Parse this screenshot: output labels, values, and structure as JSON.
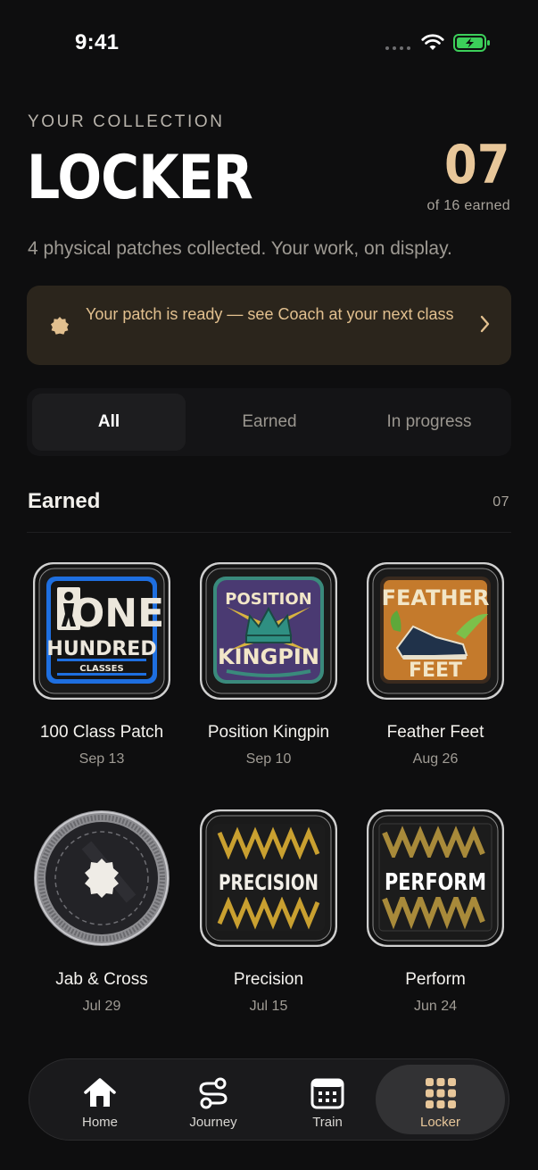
{
  "status_bar": {
    "time": "9:41"
  },
  "header": {
    "eyebrow": "YOUR COLLECTION",
    "title": "LOCKER",
    "count": "07",
    "count_sub": "of 16 earned",
    "subtitle": "4 physical patches collected. Your work, on display."
  },
  "banner": {
    "text": "Your patch is ready — see Coach at your next class",
    "accent": "#e2c08f"
  },
  "segments": [
    {
      "label": "All",
      "active": true
    },
    {
      "label": "Earned",
      "active": false
    },
    {
      "label": "In progress",
      "active": false
    }
  ],
  "section": {
    "title": "Earned",
    "count": "07"
  },
  "patches": [
    {
      "name": "100 Class Patch",
      "date": "Sep 13",
      "art": [
        "ONE",
        "HUNDRED",
        "CLASSES"
      ]
    },
    {
      "name": "Position Kingpin",
      "date": "Sep 10",
      "art": [
        "POSITION",
        "KINGPIN"
      ]
    },
    {
      "name": "Feather Feet",
      "date": "Aug 26",
      "art": [
        "FEATHER",
        "FEET"
      ]
    },
    {
      "name": "Jab & Cross",
      "date": "Jul 29"
    },
    {
      "name": "Precision",
      "date": "Jul 15",
      "art": [
        "PRECISION"
      ]
    },
    {
      "name": "Perform",
      "date": "Jun 24",
      "art": [
        "PERFORM"
      ]
    }
  ],
  "tabs": [
    {
      "label": "Home",
      "icon": "home-icon"
    },
    {
      "label": "Journey",
      "icon": "route-icon"
    },
    {
      "label": "Train",
      "icon": "calendar-icon"
    },
    {
      "label": "Locker",
      "icon": "grid-icon",
      "active": true
    }
  ],
  "colors": {
    "accent": "#e8c79a",
    "background": "#0e0e0f"
  }
}
